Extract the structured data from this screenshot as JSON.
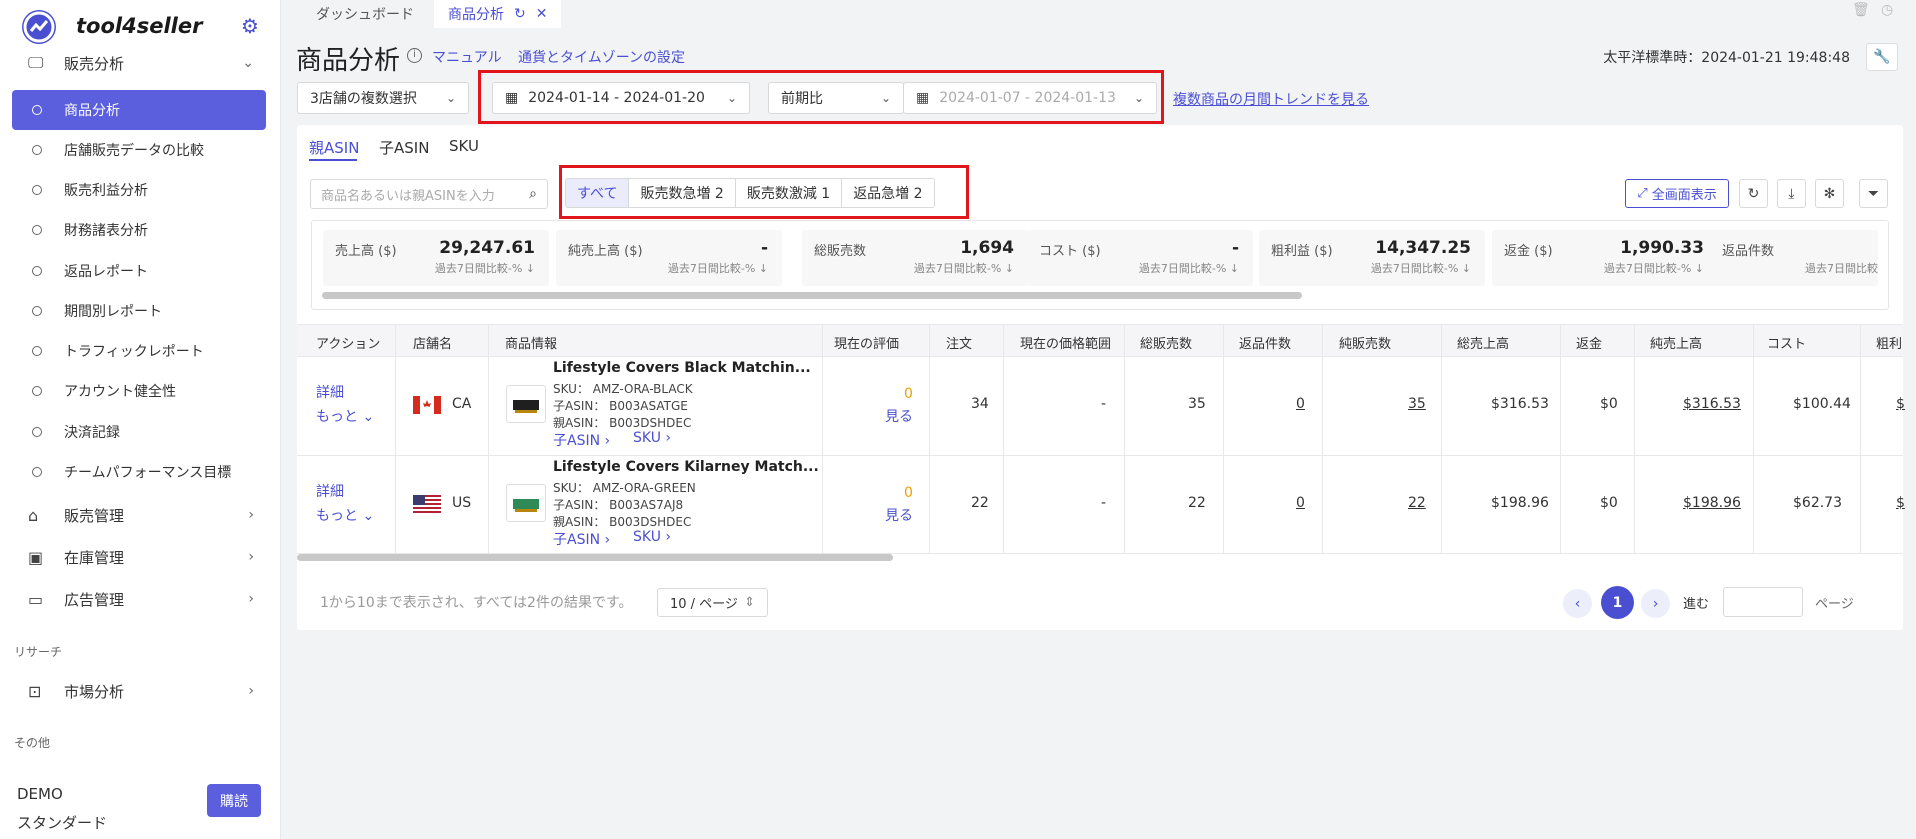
{
  "sidebar": {
    "logo_text": "tool4seller",
    "groups": {
      "sales_analysis": "販売分析",
      "sales_mgmt": "販売管理",
      "inventory_mgmt": "在庫管理",
      "ads_mgmt": "広告管理",
      "market_analysis": "市場分析"
    },
    "sub_items": [
      "商品分析",
      "店舗販売データの比較",
      "販売利益分析",
      "財務諸表分析",
      "返品レポート",
      "期間別レポート",
      "トラフィックレポート",
      "アカウント健全性",
      "決済記録",
      "チームパフォーマンス目標"
    ],
    "section_research": "リサーチ",
    "section_other": "その他",
    "user_name": "DEMO",
    "user_plan": "スタンダード",
    "buy_label": "購読"
  },
  "tabs": {
    "dashboard": "ダッシュボード",
    "product_analysis": "商品分析"
  },
  "header": {
    "title": "商品分析",
    "manual_link": "マニュアル",
    "currency_link": "通貨とタイムゾーンの設定",
    "timezone": "太平洋標準時：2024-01-21 19:48:48"
  },
  "filters": {
    "store_select": "3店舗の複数選択",
    "date_range": "2024-01-14 - 2024-01-20",
    "compare_select": "前期比",
    "compare_range": "2024-01-07 - 2024-01-13",
    "trend_link": "複数商品の月間トレンドを見る"
  },
  "sub_tabs": [
    "親ASIN",
    "子ASIN",
    "SKU"
  ],
  "search": {
    "placeholder": "商品名あるいは親ASINを入力"
  },
  "quick_filters": [
    "すべて",
    "販売数急増 2",
    "販売数激減 1",
    "返品急増 2"
  ],
  "fullscreen_label": "全画面表示",
  "metrics": [
    {
      "label": "売上高 ($)",
      "value": "29,247.61",
      "sub": "過去7日間比較-% ↓"
    },
    {
      "label": "純売上高 ($)",
      "value": "-",
      "sub": "過去7日間比較-% ↓"
    },
    {
      "label": "総販売数",
      "value": "1,694",
      "sub": "過去7日間比較-% ↓"
    },
    {
      "label": "コスト ($)",
      "value": "-",
      "sub": "過去7日間比較-% ↓"
    },
    {
      "label": "粗利益 ($)",
      "value": "14,347.25",
      "sub": "過去7日間比較-% ↓"
    },
    {
      "label": "返金 ($)",
      "value": "1,990.33",
      "sub": "過去7日間比較-% ↓"
    },
    {
      "label": "返品件数",
      "value": "",
      "sub": "過去7日間比較"
    }
  ],
  "table": {
    "headers": [
      "アクション",
      "店舗名",
      "商品情報",
      "現在の評価",
      "注文",
      "現在の価格範囲",
      "総販売数",
      "返品件数",
      "純販売数",
      "総売上高",
      "返金",
      "純売上高",
      "コスト",
      "粗利"
    ],
    "rows": [
      {
        "detail": "詳細",
        "more": "もっと",
        "country": "CA",
        "title": "Lifestyle Covers Black Matchin...",
        "sku": "SKU： AMZ-ORA-BLACK",
        "child_asin": "子ASIN： B003ASATGE",
        "parent_asin": "親ASIN： B003DSHDEC",
        "child_link": "子ASIN",
        "sku_link": "SKU",
        "rating": "0",
        "view": "見る",
        "orders": "34",
        "price_range": "-",
        "total_units": "35",
        "returns": "0",
        "net_units": "35",
        "gross_sales": "$316.53",
        "refund": "$0",
        "net_sales": "$316.53",
        "cost": "$100.44",
        "gross_profit": "$"
      },
      {
        "detail": "詳細",
        "more": "もっと",
        "country": "US",
        "title": "Lifestyle Covers Kilarney Match...",
        "sku": "SKU： AMZ-ORA-GREEN",
        "child_asin": "子ASIN： B003AS7AJ8",
        "parent_asin": "親ASIN： B003DSHDEC",
        "child_link": "子ASIN",
        "sku_link": "SKU",
        "rating": "0",
        "view": "見る",
        "orders": "22",
        "price_range": "-",
        "total_units": "22",
        "returns": "0",
        "net_units": "22",
        "gross_sales": "$198.96",
        "refund": "$0",
        "net_sales": "$198.96",
        "cost": "$62.73",
        "gross_profit": "$"
      }
    ]
  },
  "pagination": {
    "summary": "1から10まで表示され、すべては2件の結果です。",
    "page_size": "10 / ページ",
    "current_page": "1",
    "goto_label": "進む",
    "page_suffix": "ページ"
  },
  "colors": {
    "accent": "#4a4fd1",
    "highlight_box": "#e0161c",
    "rating": "#f0a000"
  }
}
